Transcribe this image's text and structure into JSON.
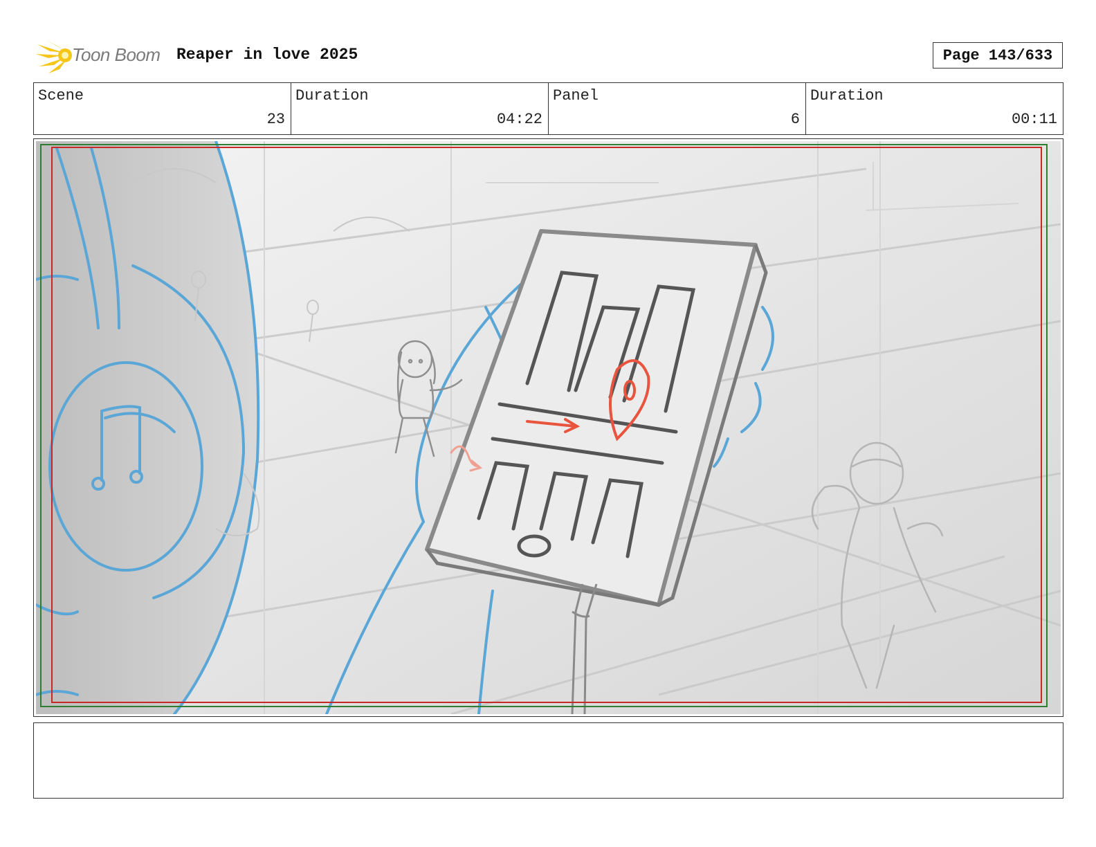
{
  "header": {
    "logo_text": "Toon Boom",
    "project_title": "Reaper in love 2025",
    "page_label": "Page 143/633"
  },
  "info": {
    "scene_label": "Scene",
    "scene_value": "23",
    "duration_label": "Duration",
    "duration_value": "04:22",
    "panel_label": "Panel",
    "panel_value": "6",
    "panel_duration_label": "Duration",
    "panel_duration_value": "00:11"
  },
  "colors": {
    "logo_yellow": "#f5c518",
    "sketch_blue": "#5aa6d6",
    "sketch_red": "#e8543e",
    "safe_frame_green": "#2e7d32",
    "safe_frame_red": "#c62828"
  },
  "notes": {
    "text": ""
  }
}
